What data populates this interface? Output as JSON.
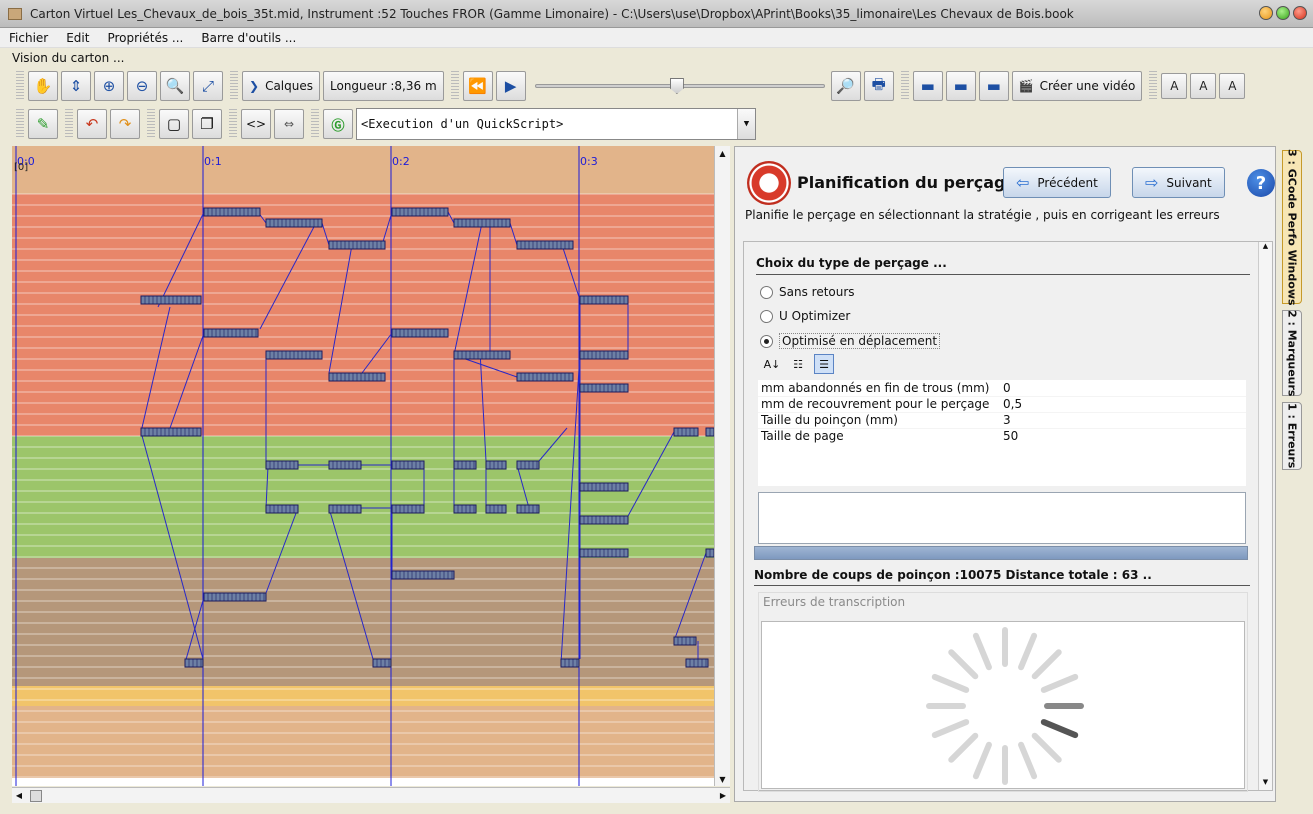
{
  "window": {
    "title": "Carton Virtuel  Les_Chevaux_de_bois_35t.mid, Instrument :52 Touches FROR (Gamme Limonaire) - C:\\Users\\use\\Dropbox\\APrint\\Books\\35_limonaire\\Les Chevaux de Bois.book"
  },
  "menu": {
    "fichier": "Fichier",
    "edit": "Edit",
    "proprietes": "Propriétés ...",
    "barre": "Barre d'outils ..."
  },
  "vision_label": "Vision du carton ...",
  "toolbar": {
    "calques": "Calques",
    "longueur": "Longueur :8,36 m",
    "creer_video": "Créer une vidéo",
    "slider_position": 0.49,
    "quickscript": "<Execution d'un QuickScript>"
  },
  "carton": {
    "markers": [
      "0:0",
      "0:1",
      "0:2",
      "0:3"
    ],
    "origin_label": "[0]"
  },
  "panel": {
    "title": "Planification du perçage",
    "prev": "Précédent",
    "next": "Suivant",
    "help": "?",
    "description": "Planifie le perçage en sélectionnant la stratégie , puis en corrigeant les erreurs",
    "section_title": "Choix du type de perçage ...",
    "options": [
      "Sans retours",
      "U Optimizer",
      "Optimisé en déplacement"
    ],
    "selected_option": "Optimisé en déplacement",
    "properties": [
      {
        "name": "mm abandonnés en fin de trous (mm)",
        "value": "0"
      },
      {
        "name": "mm de recouvrement pour le perçage",
        "value": "0,5"
      },
      {
        "name": "Taille du poinçon (mm)",
        "value": "3"
      },
      {
        "name": "Taille de page",
        "value": "50"
      }
    ],
    "stats": "Nombre de coups de poinçon :10075   Distance totale : 63 ..",
    "errors_title": "Erreurs de transcription"
  },
  "side_tabs": [
    "3 : GCode Perfo Windows",
    "2 : Marqueurs",
    "1 : Erreurs"
  ],
  "colors": {
    "carton_base": "#e2b48a",
    "band_red": "#e8866a",
    "band_green": "#9cc56a",
    "band_brown": "#b5977a",
    "band_yellow": "#f1c46a",
    "marker_line": "#1c1cd8",
    "hole": "#6d80a5"
  }
}
